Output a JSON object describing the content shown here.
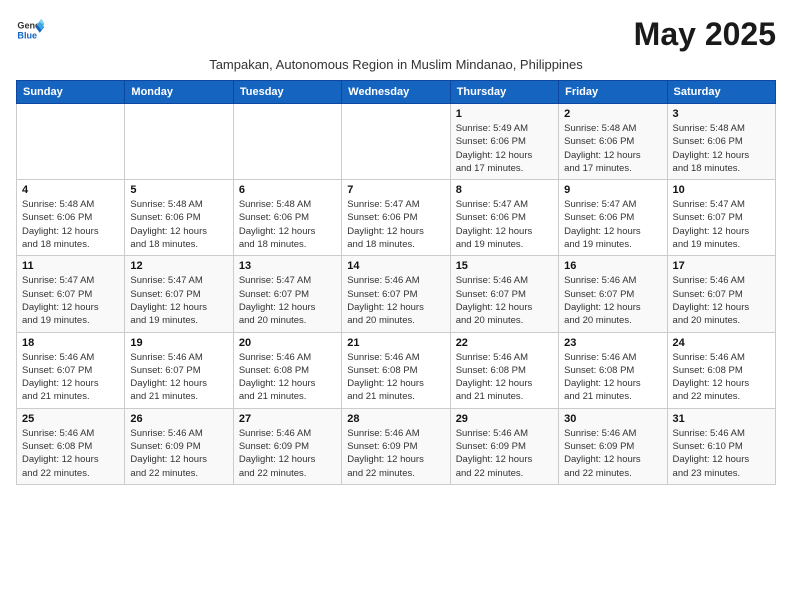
{
  "header": {
    "logo_general": "General",
    "logo_blue": "Blue",
    "month_title": "May 2025",
    "subtitle": "Tampakan, Autonomous Region in Muslim Mindanao, Philippines"
  },
  "days_of_week": [
    "Sunday",
    "Monday",
    "Tuesday",
    "Wednesday",
    "Thursday",
    "Friday",
    "Saturday"
  ],
  "weeks": [
    [
      {
        "day": "",
        "info": ""
      },
      {
        "day": "",
        "info": ""
      },
      {
        "day": "",
        "info": ""
      },
      {
        "day": "",
        "info": ""
      },
      {
        "day": "1",
        "info": "Sunrise: 5:49 AM\nSunset: 6:06 PM\nDaylight: 12 hours\nand 17 minutes."
      },
      {
        "day": "2",
        "info": "Sunrise: 5:48 AM\nSunset: 6:06 PM\nDaylight: 12 hours\nand 17 minutes."
      },
      {
        "day": "3",
        "info": "Sunrise: 5:48 AM\nSunset: 6:06 PM\nDaylight: 12 hours\nand 18 minutes."
      }
    ],
    [
      {
        "day": "4",
        "info": "Sunrise: 5:48 AM\nSunset: 6:06 PM\nDaylight: 12 hours\nand 18 minutes."
      },
      {
        "day": "5",
        "info": "Sunrise: 5:48 AM\nSunset: 6:06 PM\nDaylight: 12 hours\nand 18 minutes."
      },
      {
        "day": "6",
        "info": "Sunrise: 5:48 AM\nSunset: 6:06 PM\nDaylight: 12 hours\nand 18 minutes."
      },
      {
        "day": "7",
        "info": "Sunrise: 5:47 AM\nSunset: 6:06 PM\nDaylight: 12 hours\nand 18 minutes."
      },
      {
        "day": "8",
        "info": "Sunrise: 5:47 AM\nSunset: 6:06 PM\nDaylight: 12 hours\nand 19 minutes."
      },
      {
        "day": "9",
        "info": "Sunrise: 5:47 AM\nSunset: 6:06 PM\nDaylight: 12 hours\nand 19 minutes."
      },
      {
        "day": "10",
        "info": "Sunrise: 5:47 AM\nSunset: 6:07 PM\nDaylight: 12 hours\nand 19 minutes."
      }
    ],
    [
      {
        "day": "11",
        "info": "Sunrise: 5:47 AM\nSunset: 6:07 PM\nDaylight: 12 hours\nand 19 minutes."
      },
      {
        "day": "12",
        "info": "Sunrise: 5:47 AM\nSunset: 6:07 PM\nDaylight: 12 hours\nand 19 minutes."
      },
      {
        "day": "13",
        "info": "Sunrise: 5:47 AM\nSunset: 6:07 PM\nDaylight: 12 hours\nand 20 minutes."
      },
      {
        "day": "14",
        "info": "Sunrise: 5:46 AM\nSunset: 6:07 PM\nDaylight: 12 hours\nand 20 minutes."
      },
      {
        "day": "15",
        "info": "Sunrise: 5:46 AM\nSunset: 6:07 PM\nDaylight: 12 hours\nand 20 minutes."
      },
      {
        "day": "16",
        "info": "Sunrise: 5:46 AM\nSunset: 6:07 PM\nDaylight: 12 hours\nand 20 minutes."
      },
      {
        "day": "17",
        "info": "Sunrise: 5:46 AM\nSunset: 6:07 PM\nDaylight: 12 hours\nand 20 minutes."
      }
    ],
    [
      {
        "day": "18",
        "info": "Sunrise: 5:46 AM\nSunset: 6:07 PM\nDaylight: 12 hours\nand 21 minutes."
      },
      {
        "day": "19",
        "info": "Sunrise: 5:46 AM\nSunset: 6:07 PM\nDaylight: 12 hours\nand 21 minutes."
      },
      {
        "day": "20",
        "info": "Sunrise: 5:46 AM\nSunset: 6:08 PM\nDaylight: 12 hours\nand 21 minutes."
      },
      {
        "day": "21",
        "info": "Sunrise: 5:46 AM\nSunset: 6:08 PM\nDaylight: 12 hours\nand 21 minutes."
      },
      {
        "day": "22",
        "info": "Sunrise: 5:46 AM\nSunset: 6:08 PM\nDaylight: 12 hours\nand 21 minutes."
      },
      {
        "day": "23",
        "info": "Sunrise: 5:46 AM\nSunset: 6:08 PM\nDaylight: 12 hours\nand 21 minutes."
      },
      {
        "day": "24",
        "info": "Sunrise: 5:46 AM\nSunset: 6:08 PM\nDaylight: 12 hours\nand 22 minutes."
      }
    ],
    [
      {
        "day": "25",
        "info": "Sunrise: 5:46 AM\nSunset: 6:08 PM\nDaylight: 12 hours\nand 22 minutes."
      },
      {
        "day": "26",
        "info": "Sunrise: 5:46 AM\nSunset: 6:09 PM\nDaylight: 12 hours\nand 22 minutes."
      },
      {
        "day": "27",
        "info": "Sunrise: 5:46 AM\nSunset: 6:09 PM\nDaylight: 12 hours\nand 22 minutes."
      },
      {
        "day": "28",
        "info": "Sunrise: 5:46 AM\nSunset: 6:09 PM\nDaylight: 12 hours\nand 22 minutes."
      },
      {
        "day": "29",
        "info": "Sunrise: 5:46 AM\nSunset: 6:09 PM\nDaylight: 12 hours\nand 22 minutes."
      },
      {
        "day": "30",
        "info": "Sunrise: 5:46 AM\nSunset: 6:09 PM\nDaylight: 12 hours\nand 22 minutes."
      },
      {
        "day": "31",
        "info": "Sunrise: 5:46 AM\nSunset: 6:10 PM\nDaylight: 12 hours\nand 23 minutes."
      }
    ]
  ]
}
